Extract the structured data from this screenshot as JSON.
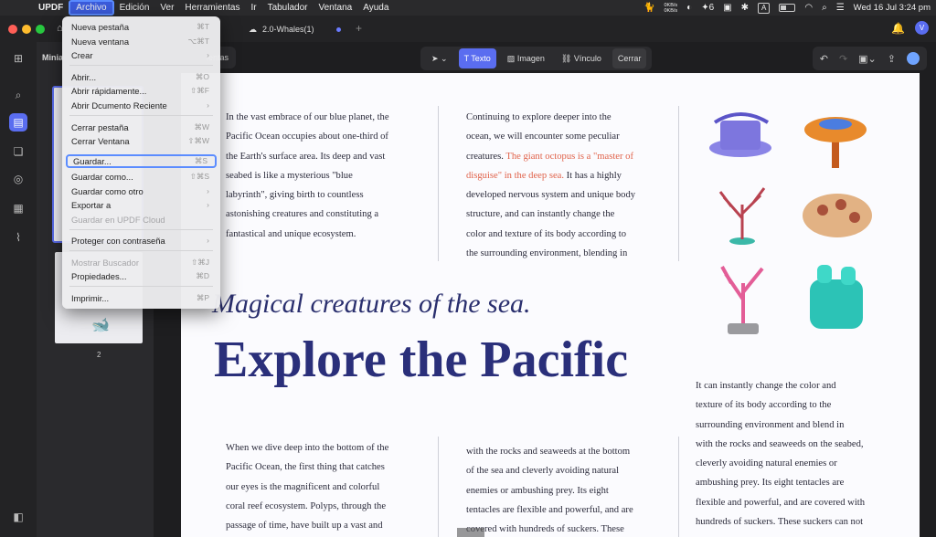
{
  "menubar": {
    "app": "UPDF",
    "items": [
      "Archivo",
      "Edición",
      "Ver",
      "Herramientas",
      "Ir",
      "Tabulador",
      "Ventana",
      "Ayuda"
    ],
    "netspeed_up": "0KB/s",
    "netspeed_down": "0KB/s",
    "badge_count": "6",
    "input_label": "A",
    "datetime": "Wed 16 Jul  3:24 pm"
  },
  "tab": {
    "title": "2.0-Whales(1)"
  },
  "avatar": {
    "letter": "V"
  },
  "thumbnails": {
    "title": "Minia",
    "page_number": "2"
  },
  "toolbar": {
    "tools": [
      "Texto",
      "Imagen",
      "Vínculo",
      "Cerrar"
    ],
    "hint_text": "ientas"
  },
  "file_menu": {
    "items": [
      {
        "label": "Nueva pestaña",
        "shortcut": "⌘T"
      },
      {
        "label": "Nueva ventana",
        "shortcut": "⌥⌘T"
      },
      {
        "label": "Crear",
        "shortcut": "›"
      },
      {
        "label": "Abrir...",
        "shortcut": "⌘O"
      },
      {
        "label": "Abrir rápidamente...",
        "shortcut": "⇧⌘F"
      },
      {
        "label": "Abrir Dcumento Reciente",
        "shortcut": "›"
      },
      {
        "label": "Cerrar pestaña",
        "shortcut": "⌘W"
      },
      {
        "label": "Cerrar Ventana",
        "shortcut": "⇧⌘W"
      },
      {
        "label": "Guardar...",
        "shortcut": "⌘S"
      },
      {
        "label": "Guardar como...",
        "shortcut": "⇧⌘S"
      },
      {
        "label": "Guardar como otro",
        "shortcut": "›"
      },
      {
        "label": "Exportar a",
        "shortcut": "›"
      },
      {
        "label": "Guardar en UPDF Cloud",
        "shortcut": ""
      },
      {
        "label": "Proteger con contraseña",
        "shortcut": "›"
      },
      {
        "label": "Mostrar Buscador",
        "shortcut": "⇧⌘J"
      },
      {
        "label": "Propiedades...",
        "shortcut": "⌘D"
      },
      {
        "label": "Imprimir...",
        "shortcut": "⌘P"
      }
    ]
  },
  "document": {
    "col1_top": [
      "In the vast embrace of our blue planet, the",
      "Pacific Ocean occupies about one-third of",
      "the Earth's surface area. Its deep and vast",
      "seabed is like a mysterious \"blue",
      "labyrinth\", giving birth to countless",
      "astonishing creatures and constituting a",
      "fantastical and unique ecosystem."
    ],
    "col2_top_a": [
      "Continuing to explore deeper into the",
      "ocean, we will encounter some peculiar"
    ],
    "col2_top_b_plain": "creatures. ",
    "col2_top_b_red": "The giant octopus is a \"master of",
    "col2_top_c_red": "disguise\" in the deep sea.",
    "col2_top_c_plain": " It has a highly",
    "col2_top_d": [
      "developed nervous system and unique body",
      "structure, and can instantly change the",
      "color and texture of its body according to",
      "the surrounding environment, blending in"
    ],
    "script_title": "Magical creatures of the sea.",
    "headline": "Explore the Pacific",
    "col3_bottom": [
      "It can instantly change the color and",
      "texture of its body according to the",
      "surrounding environment and blend in",
      "with the rocks and seaweeds on the seabed,",
      "cleverly avoiding natural enemies or",
      "ambushing prey. Its eight tentacles are",
      "flexible and powerful, and are covered with",
      "hundreds of suckers. These suckers can not"
    ],
    "col1_bottom": [
      "When we dive deep into the bottom of the",
      "Pacific Ocean, the first thing that catches",
      "our eyes is the magnificent and colorful",
      "coral reef ecosystem. Polyps, through the",
      "passage of time, have built up a vast and"
    ],
    "col2_bottom": [
      "with the rocks and seaweeds at the bottom",
      "of the sea and cleverly avoiding natural",
      "enemies or ambushing prey. Its eight",
      "tentacles are flexible and powerful, and are",
      "covered with hundreds of suckers. These"
    ]
  }
}
